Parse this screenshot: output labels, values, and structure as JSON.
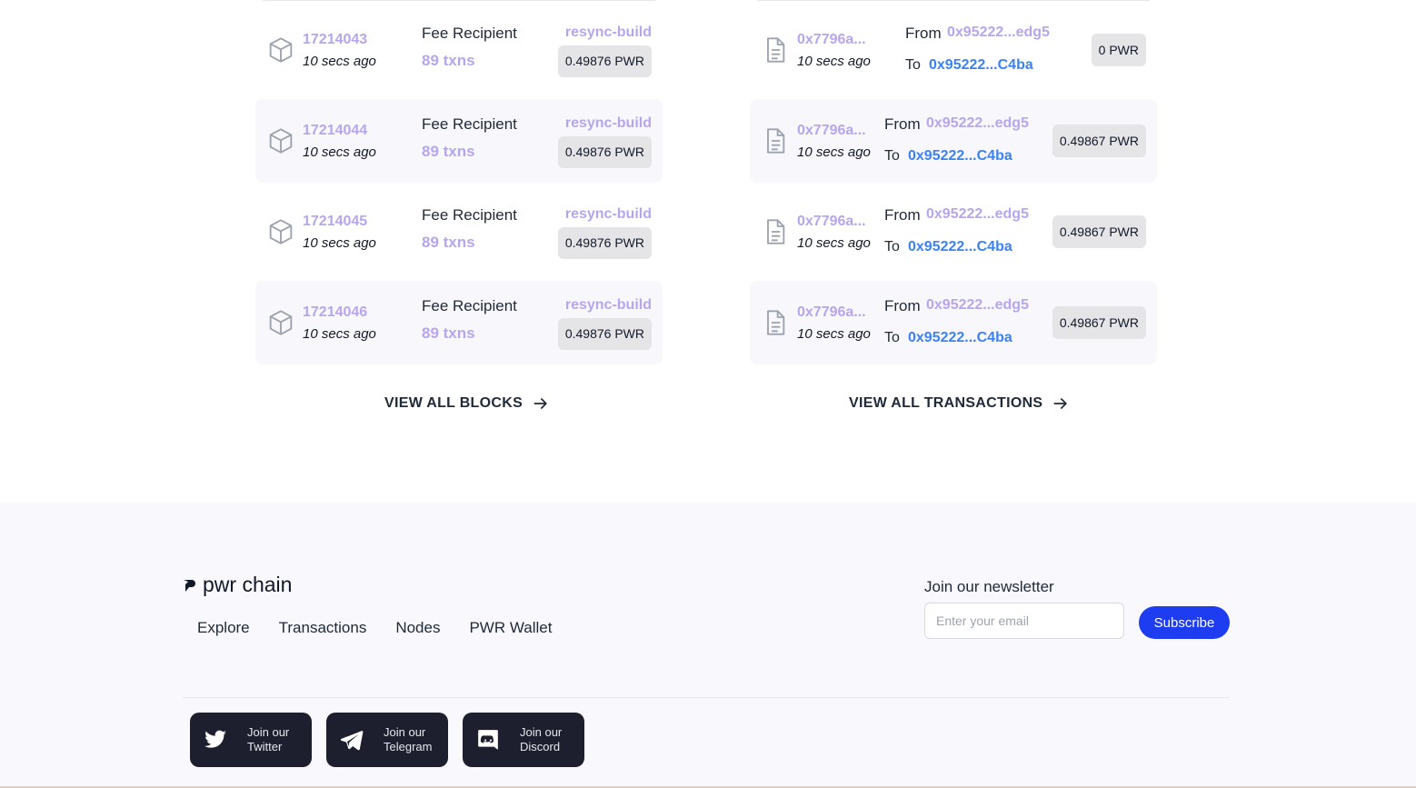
{
  "blocks": {
    "rows": [
      {
        "number": "17214043",
        "age": "10 secs ago",
        "fee_label": "Fee Recipient",
        "txns": "89 txns",
        "builder": "resync-build",
        "reward": "0.49876 PWR"
      },
      {
        "number": "17214044",
        "age": "10 secs ago",
        "fee_label": "Fee Recipient",
        "txns": "89 txns",
        "builder": "resync-build",
        "reward": "0.49876 PWR"
      },
      {
        "number": "17214045",
        "age": "10 secs ago",
        "fee_label": "Fee Recipient",
        "txns": "89 txns",
        "builder": "resync-build",
        "reward": "0.49876 PWR"
      },
      {
        "number": "17214046",
        "age": "10 secs ago",
        "fee_label": "Fee Recipient",
        "txns": "89 txns",
        "builder": "resync-build",
        "reward": "0.49876 PWR"
      }
    ],
    "view_all": "VIEW ALL BLOCKS"
  },
  "transactions": {
    "rows": [
      {
        "hash": "0x7796a...",
        "age": "10 secs ago",
        "from_label": "From",
        "from": "0x95222...edg5",
        "to_label": "To",
        "to": "0x95222...C4ba",
        "amount": "0 PWR"
      },
      {
        "hash": "0x7796a...",
        "age": "10 secs ago",
        "from_label": "From",
        "from": "0x95222...edg5",
        "to_label": "To",
        "to": "0x95222...C4ba",
        "amount": "0.49867 PWR"
      },
      {
        "hash": "0x7796a...",
        "age": "10 secs ago",
        "from_label": "From",
        "from": "0x95222...edg5",
        "to_label": "To",
        "to": "0x95222...C4ba",
        "amount": "0.49867 PWR"
      },
      {
        "hash": "0x7796a...",
        "age": "10 secs ago",
        "from_label": "From",
        "from": "0x95222...edg5",
        "to_label": "To",
        "to": "0x95222...C4ba",
        "amount": "0.49867 PWR"
      }
    ],
    "view_all": "VIEW ALL TRANSACTIONS"
  },
  "footer": {
    "logo_text": "pwr chain",
    "nav": [
      "Explore",
      "Transactions",
      "Nodes",
      "PWR Wallet"
    ],
    "newsletter_label": "Join our newsletter",
    "email_placeholder": "Enter your email",
    "subscribe_label": "Subscribe",
    "social": [
      {
        "icon": "twitter-icon",
        "line1": "Join our",
        "line2": "Twitter"
      },
      {
        "icon": "telegram-icon",
        "line1": "Join our",
        "line2": "Telegram"
      },
      {
        "icon": "discord-icon",
        "line1": "Join our",
        "line2": "Discord"
      }
    ]
  },
  "colors": {
    "accent_purple": "#b7a6ee",
    "link_blue": "#3b82f6",
    "subscribe_blue": "#1f3df0",
    "social_dark": "#1e1f2e"
  }
}
